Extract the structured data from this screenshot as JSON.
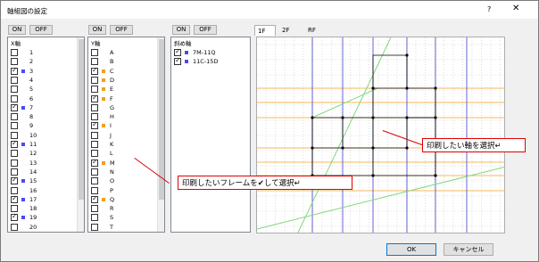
{
  "window": {
    "title": "軸組図の設定",
    "help": "?",
    "close": "✕"
  },
  "x_panel": {
    "on": "ON",
    "off": "OFF",
    "header": "X軸",
    "items": [
      {
        "label": "1",
        "checked": false,
        "color": ""
      },
      {
        "label": "2",
        "checked": false,
        "color": ""
      },
      {
        "label": "3",
        "checked": true,
        "color": "#4a4af0"
      },
      {
        "label": "4",
        "checked": false,
        "color": ""
      },
      {
        "label": "5",
        "checked": false,
        "color": ""
      },
      {
        "label": "6",
        "checked": false,
        "color": ""
      },
      {
        "label": "7",
        "checked": true,
        "color": "#4a4af0"
      },
      {
        "label": "8",
        "checked": false,
        "color": ""
      },
      {
        "label": "9",
        "checked": false,
        "color": ""
      },
      {
        "label": "10",
        "checked": false,
        "color": ""
      },
      {
        "label": "11",
        "checked": true,
        "color": "#4a4af0"
      },
      {
        "label": "12",
        "checked": false,
        "color": ""
      },
      {
        "label": "13",
        "checked": false,
        "color": ""
      },
      {
        "label": "14",
        "checked": false,
        "color": ""
      },
      {
        "label": "15",
        "checked": true,
        "color": "#4a4af0"
      },
      {
        "label": "16",
        "checked": false,
        "color": ""
      },
      {
        "label": "17",
        "checked": true,
        "color": "#4a4af0"
      },
      {
        "label": "18",
        "checked": false,
        "color": ""
      },
      {
        "label": "19",
        "checked": true,
        "color": "#4a4af0"
      },
      {
        "label": "20",
        "checked": false,
        "color": ""
      }
    ]
  },
  "y_panel": {
    "on": "ON",
    "off": "OFF",
    "header": "Y軸",
    "items": [
      {
        "label": "A",
        "checked": false,
        "color": ""
      },
      {
        "label": "B",
        "checked": false,
        "color": ""
      },
      {
        "label": "C",
        "checked": true,
        "color": "#f0a020"
      },
      {
        "label": "D",
        "checked": false,
        "color": "#f0a020"
      },
      {
        "label": "E",
        "checked": false,
        "color": "#f0a020"
      },
      {
        "label": "F",
        "checked": true,
        "color": "#f0a020"
      },
      {
        "label": "G",
        "checked": false,
        "color": ""
      },
      {
        "label": "H",
        "checked": false,
        "color": ""
      },
      {
        "label": "I",
        "checked": true,
        "color": "#f0a020"
      },
      {
        "label": "J",
        "checked": false,
        "color": ""
      },
      {
        "label": "K",
        "checked": false,
        "color": ""
      },
      {
        "label": "L",
        "checked": false,
        "color": ""
      },
      {
        "label": "M",
        "checked": true,
        "color": "#f0a020"
      },
      {
        "label": "N",
        "checked": false,
        "color": ""
      },
      {
        "label": "O",
        "checked": false,
        "color": ""
      },
      {
        "label": "P",
        "checked": false,
        "color": ""
      },
      {
        "label": "Q",
        "checked": true,
        "color": "#f0a020"
      },
      {
        "label": "R",
        "checked": false,
        "color": ""
      },
      {
        "label": "S",
        "checked": false,
        "color": ""
      },
      {
        "label": "T",
        "checked": false,
        "color": ""
      }
    ]
  },
  "diag_panel": {
    "on": "ON",
    "off": "OFF",
    "header": "斜め軸",
    "items": [
      {
        "label": "7M-11Q",
        "checked": true,
        "color": "#4a4af0"
      },
      {
        "label": "11C-15D",
        "checked": true,
        "color": "#4a4af0"
      }
    ]
  },
  "tabs": [
    "1F",
    "2F",
    "RF"
  ],
  "callouts": {
    "frame": "印刷したいフレームを✔して選択↵",
    "axis": "印刷したい軸を選択↵"
  },
  "buttons": {
    "ok": "OK",
    "cancel": "キャンセル"
  },
  "colors": {
    "x_axis": "#4040d0",
    "y_axis": "#f0a020",
    "diagonal": "#80e080",
    "frame": "#000000",
    "accent": "#e00000"
  }
}
